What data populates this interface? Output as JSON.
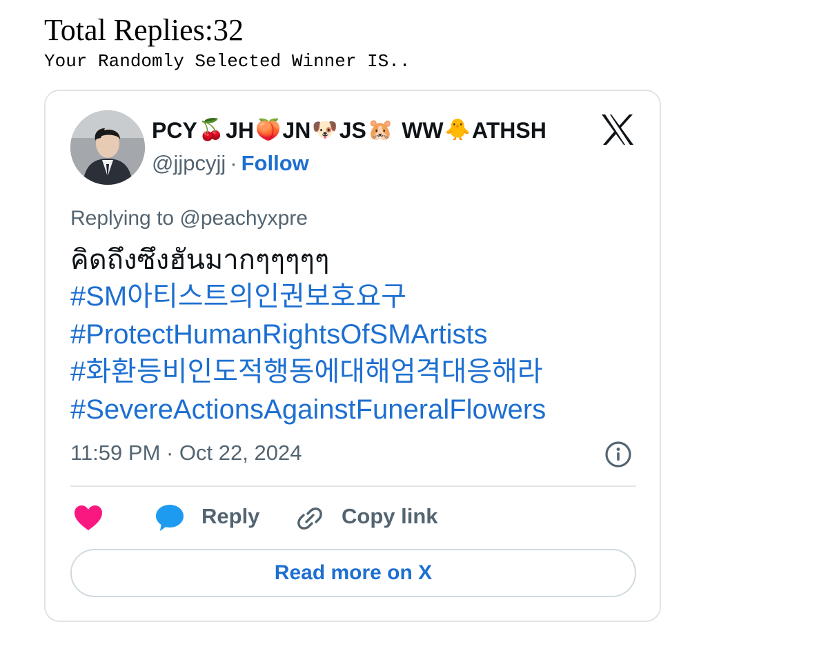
{
  "header": {
    "total_replies": "Total Replies:32",
    "winner_text": "Your Randomly Selected Winner IS.."
  },
  "tweet": {
    "display_name_parts": [
      {
        "text": "PCY",
        "emoji": "🍒"
      },
      {
        "text": "JH",
        "emoji": "🍑"
      },
      {
        "text": "JN",
        "emoji": "🐶"
      },
      {
        "text": "JS",
        "emoji": "🐹"
      },
      {
        "text": " WW",
        "emoji": "🐥"
      },
      {
        "text": "ATHSH",
        "emoji": ""
      }
    ],
    "handle": "@jjpcyjj",
    "separator": "·",
    "follow_label": "Follow",
    "replying_to": "Replying to @peachyxpre",
    "text": "คิดถึงซึงฮันมากๆๆๆๆๆ",
    "hashtags": [
      "#SM아티스트의인권보호요구",
      "#ProtectHumanRightsOfSMArtists",
      "#화환등비인도적행동에대해엄격대응해라",
      "#SevereActionsAgainstFuneralFlowers"
    ],
    "timestamp": "11:59 PM · Oct 22, 2024",
    "actions": {
      "reply_label": "Reply",
      "copy_link_label": "Copy link"
    },
    "read_more_label": "Read more on X"
  },
  "colors": {
    "link_blue": "#1d6fd1",
    "secondary_text": "#536471",
    "heart_pink": "#f91880",
    "reply_blue": "#1d9bf0",
    "border": "#dfe3e7"
  },
  "icons": [
    "avatar",
    "x-logo-icon",
    "info-icon",
    "heart-icon",
    "reply-bubble-icon",
    "link-icon"
  ]
}
